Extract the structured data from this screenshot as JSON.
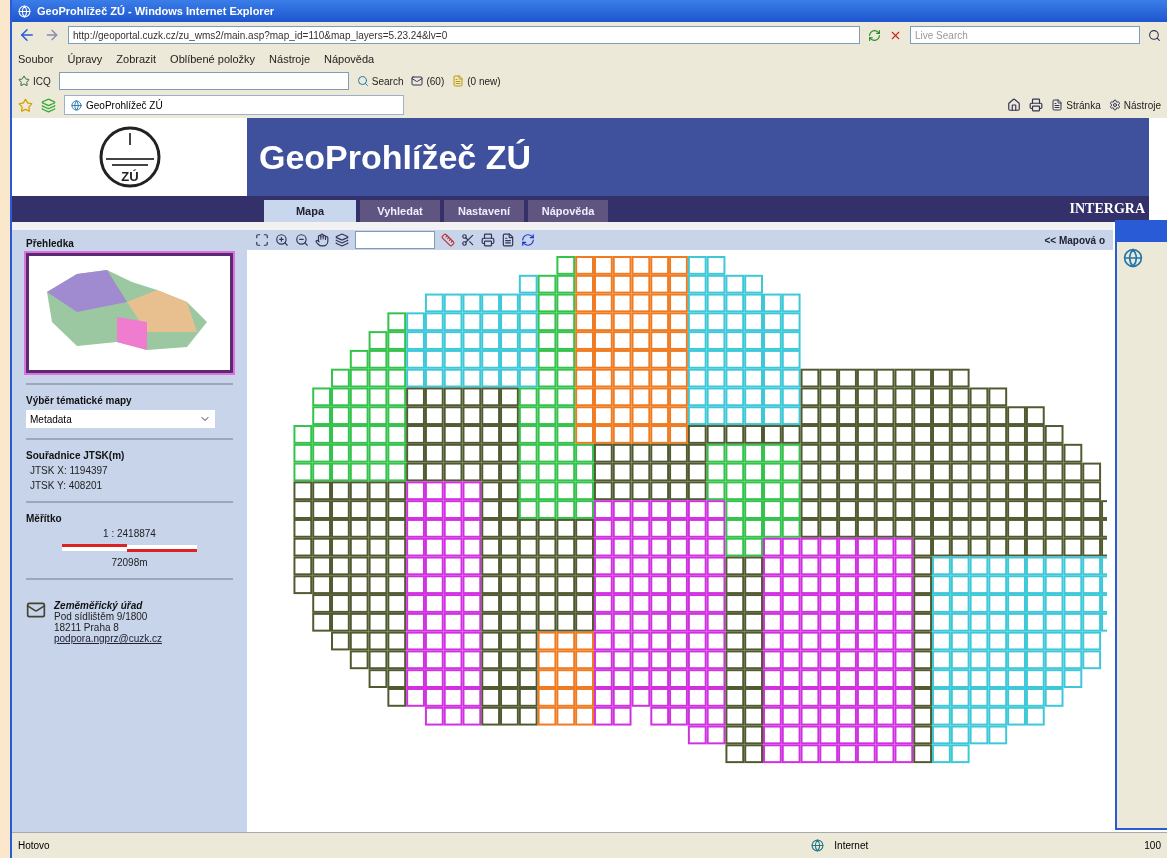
{
  "window": {
    "title": "GeoProhlížeč ZÚ - Windows Internet Explorer"
  },
  "address_bar": {
    "url": "http://geoportal.cuzk.cz/zu_wms2/main.asp?map_id=110&map_layers=5.23.24&lv=0",
    "search_placeholder": "Live Search"
  },
  "menu": [
    "Soubor",
    "Úpravy",
    "Zobrazit",
    "Oblíbené položky",
    "Nástroje",
    "Nápověda"
  ],
  "toolbar": {
    "icq": "ICQ",
    "search": "Search",
    "mail_count": "(60)",
    "news": "(0 new)"
  },
  "tabs": [
    {
      "label": "GeoProhlížeč ZÚ",
      "selected": true
    }
  ],
  "command_bar": [
    "Stránka",
    "Nástroje"
  ],
  "page": {
    "logo_text": "ZÚ",
    "title": "GeoProhlížeč ZÚ",
    "partner_logo": "INTERGRA",
    "nav": [
      {
        "label": "Mapa",
        "selected": true
      },
      {
        "label": "Vyhledat",
        "selected": false
      },
      {
        "label": "Nastavení",
        "selected": false
      },
      {
        "label": "Nápověda",
        "selected": false
      }
    ]
  },
  "map_toolbar": {
    "link": "<< Mapová o"
  },
  "sidebar": {
    "overview_title": "Přehledka",
    "theme_label": "Výběr tématické mapy",
    "theme_value": "Metadata",
    "coords_title": "Souřadnice JTSK(m)",
    "coord_x": "JTSK X: 1194397",
    "coord_y": "JTSK Y: 408201",
    "scale_title": "Měřítko",
    "scale_ratio": "1 : 2418874",
    "scale_length": "72098m",
    "contact_name": "Zeměměřický úřad",
    "contact_street": "Pod sídlištěm 9/1800",
    "contact_city": "18211 Praha 8",
    "contact_email": "podpora.ngprz@cuzk.cz"
  },
  "status_bar": {
    "status": "Hotovo",
    "zone": "Internet",
    "zoom": "100"
  }
}
